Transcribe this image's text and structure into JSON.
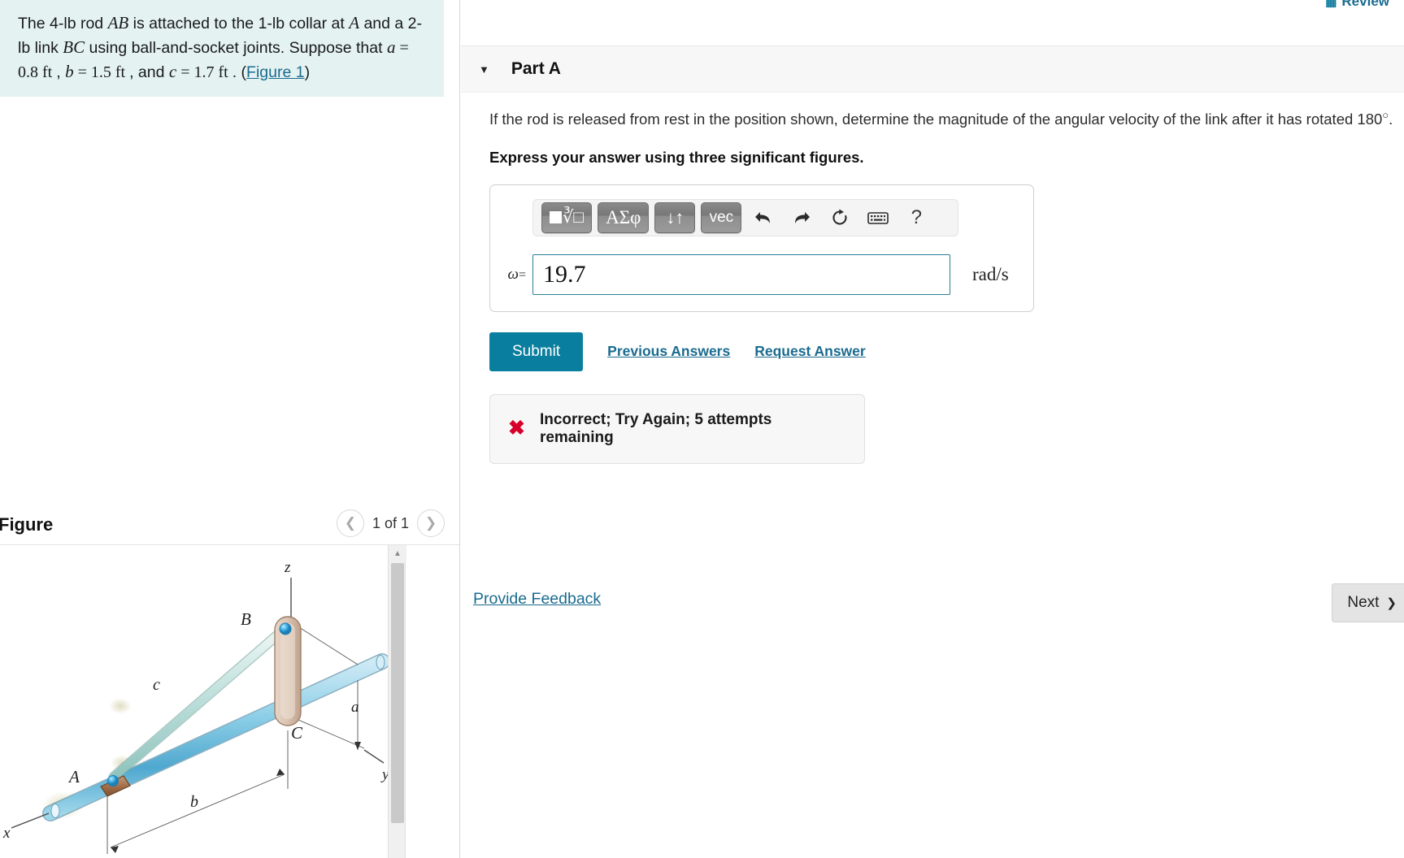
{
  "review": {
    "label": "Review",
    "icon": "bar-chart-icon"
  },
  "problem": {
    "line1_pre": "The 4-lb rod ",
    "var_AB": "AB",
    "line1_mid": " is attached to the 1-lb collar at ",
    "var_A": "A",
    "line1_post": " and a 2-lb link ",
    "var_BC": "BC",
    "line2": " using ball-and-socket joints. Suppose that ",
    "var_a": "a",
    "a_value": " = 0.8 ft ",
    "comma1": ", ",
    "var_b": "b",
    "b_value": " = 1.5 ft ",
    "comma2": ", and ",
    "var_c": "c",
    "c_value": " = 1.7 ft ",
    "period": ". (",
    "figure_link": "Figure 1",
    "close_paren": ")"
  },
  "figure": {
    "title": "Figure",
    "pager_label": "1 of 1",
    "prev_icon": "chevron-left-icon",
    "next_icon": "chevron-right-icon",
    "labels": {
      "z": "z",
      "y": "y",
      "x": "x",
      "A": "A",
      "B": "B",
      "C": "C",
      "a": "a",
      "b": "b",
      "c": "c"
    },
    "colors": {
      "rod": "#7ec4e0",
      "link": "#bfe0dd",
      "collar": "#9e6b46",
      "bracket": "#d9c2b0",
      "joint": "#2ba6e0"
    }
  },
  "part": {
    "title": "Part A",
    "caret_icon": "caret-down-icon",
    "question_1": "If the rod is released from rest in the position shown, determine the magnitude of the angular velocity of the link after it has rotated 180",
    "degree": "○",
    "question_2": ".",
    "instruction": "Express your answer using three significant figures."
  },
  "toolbar": {
    "buttons": [
      {
        "name": "template-math-button",
        "label": "√",
        "type": "template"
      },
      {
        "name": "greek-symbols-button",
        "label": "ΑΣφ",
        "type": "greek"
      },
      {
        "name": "undo-redo-arrows-button",
        "label": "↓↑",
        "type": "arrows"
      },
      {
        "name": "vector-button",
        "label": "vec",
        "type": "vec"
      }
    ],
    "icons": [
      {
        "name": "undo-icon",
        "glyph": "↩"
      },
      {
        "name": "redo-icon",
        "glyph": "↪"
      },
      {
        "name": "reset-icon",
        "glyph": "↻"
      },
      {
        "name": "keyboard-icon",
        "glyph": "⌨"
      },
      {
        "name": "help-icon",
        "glyph": "?"
      }
    ]
  },
  "answer": {
    "symbol": "ω",
    "equals": "=",
    "value": "19.7",
    "placeholder": "",
    "units": "rad/s"
  },
  "actions": {
    "submit": "Submit",
    "previous_answers": "Previous Answers",
    "request_answer": "Request Answer"
  },
  "feedback": {
    "icon": "x-mark-icon",
    "message": "Incorrect; Try Again; 5 attempts remaining"
  },
  "footer": {
    "provide_feedback": "Provide Feedback",
    "next": "Next",
    "next_icon": "chevron-right-icon"
  },
  "colors": {
    "accent_teal": "#0a7e9e",
    "link": "#1a6b8f",
    "statement_bg": "#e4f2f2",
    "error_red": "#d8002a"
  }
}
